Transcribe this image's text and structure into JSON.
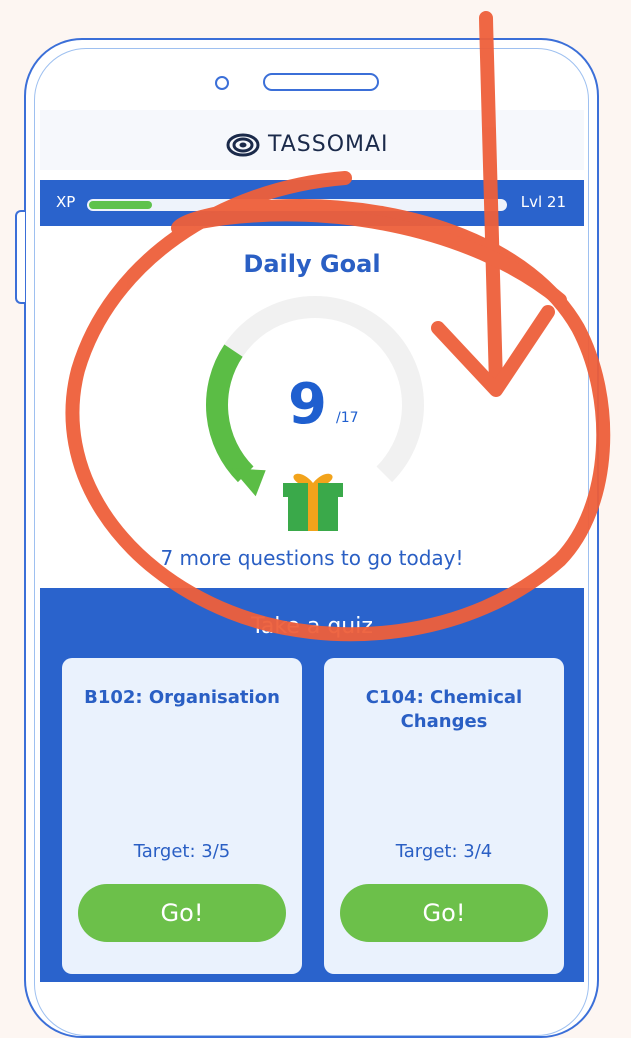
{
  "app": {
    "logo_text": "TASSOMAI"
  },
  "xp": {
    "label": "XP",
    "progress": 0.15,
    "level": "Lvl 21"
  },
  "daily_goal": {
    "title": "Daily Goal",
    "current": "9",
    "total_label": "/17",
    "progress": 0.53,
    "remaining_text": "7 more questions to go today!"
  },
  "section": {
    "title": "Take a quiz"
  },
  "cards": [
    {
      "title": "B102: Organisation",
      "target": "Target: 3/5",
      "button": "Go!"
    },
    {
      "title": "C104: Chemical Changes",
      "target": "Target: 3/4",
      "button": "Go!"
    }
  ],
  "colors": {
    "brand_blue": "#2a63cc",
    "green": "#5fc24d",
    "marker_orange": "#ee5f3a"
  },
  "icons": {
    "logo": "spiral-logo-icon",
    "gift": "gift-icon"
  }
}
